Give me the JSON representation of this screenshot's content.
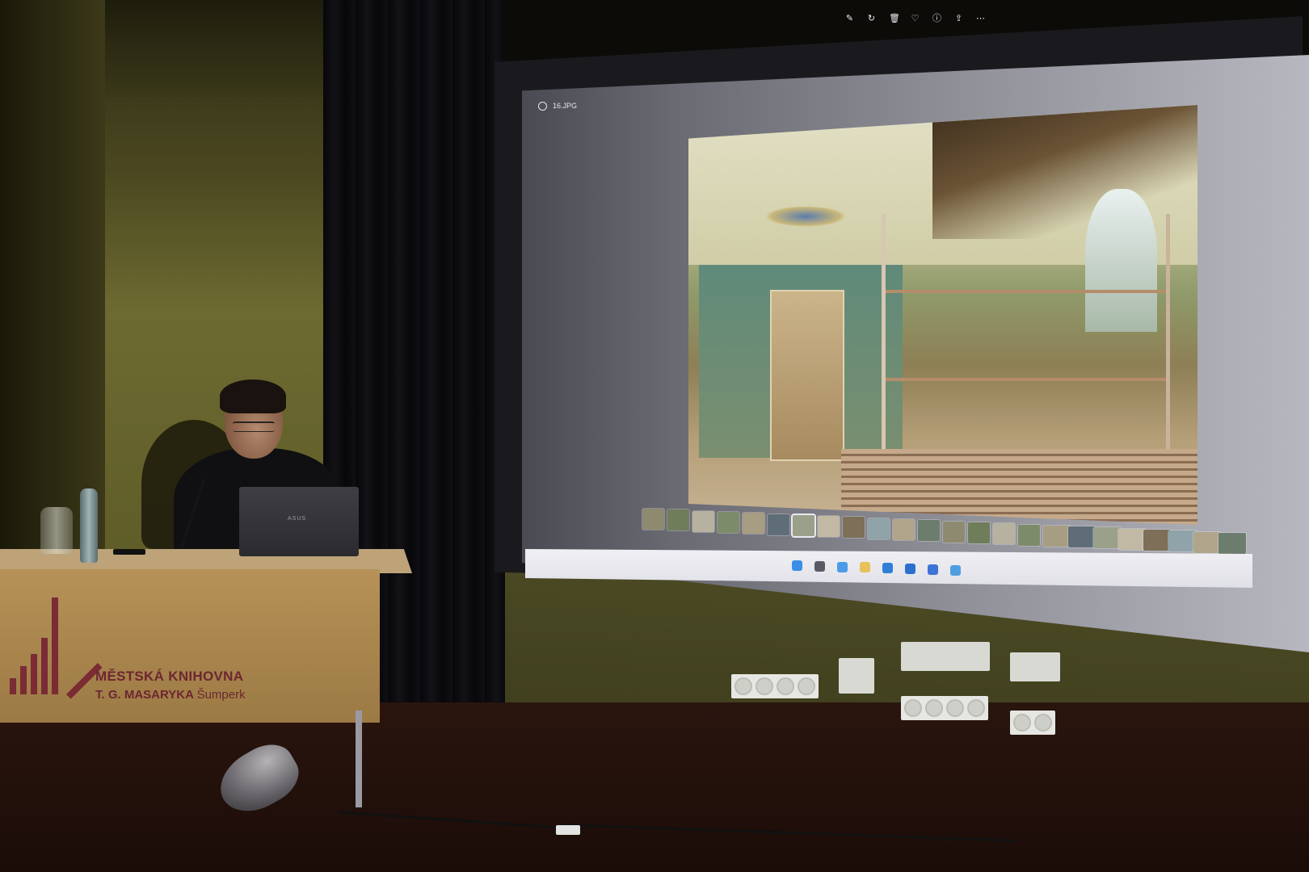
{
  "screen": {
    "file_name": "16.JPG",
    "toolbar_icons": [
      "edit-icon",
      "rotate-icon",
      "delete-icon",
      "favorite-icon",
      "info-icon",
      "share-icon",
      "more-icon"
    ],
    "taskbar_icons": [
      "windows-start-icon",
      "search-icon",
      "file-explorer-icon",
      "edge-icon",
      "photos-icon",
      "mail-icon",
      "store-icon",
      "app-icon"
    ],
    "filmstrip_count": 24,
    "filmstrip_selected": 7
  },
  "desk_sign": {
    "line1": "MĚSTSKÁ KNIHOVNA",
    "line2_bold": "T. G. MASARYKA",
    "line2_light": "Šumperk"
  },
  "laptop": {
    "brand": "ASUS"
  },
  "colors": {
    "logo": "#6d2631",
    "desk": "#b69258",
    "screen_light": "#b7b7c0"
  }
}
